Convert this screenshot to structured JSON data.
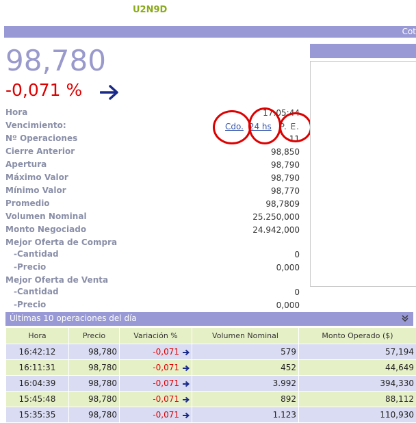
{
  "ticker": "U2N9D",
  "topbar_right": "Cot",
  "price": "98,780",
  "variation": "-0,071 %",
  "colors": {
    "accent": "#9999d6",
    "negative": "#dd0000",
    "row_odd": "#d9dcf2",
    "row_even": "#e6f0c6",
    "ticker": "#8aaa1a"
  },
  "details": {
    "hora": {
      "label": "Hora",
      "value": "17:05:44"
    },
    "vencimiento": {
      "label": "Vencimiento:",
      "link_cdo": "Cdo.",
      "link_24hs": "24 hs",
      "pe": "P. E."
    },
    "num_ops": {
      "label": "Nº Operaciones",
      "value": "11"
    },
    "cierre_anterior": {
      "label": "Cierre Anterior",
      "value": "98,850"
    },
    "apertura": {
      "label": "Apertura",
      "value": "98,790"
    },
    "maximo": {
      "label": "Máximo Valor",
      "value": "98,790"
    },
    "minimo": {
      "label": "Mínimo Valor",
      "value": "98,770"
    },
    "promedio": {
      "label": "Promedio",
      "value": "98,7809"
    },
    "vol_nominal": {
      "label": "Volumen Nominal",
      "value": "25.250,000"
    },
    "monto_neg": {
      "label": "Monto Negociado",
      "value": "24.942,000"
    },
    "mejor_compra": {
      "label": "Mejor Oferta de Compra"
    },
    "compra_cantidad": {
      "label": "-Cantidad",
      "value": "0"
    },
    "compra_precio": {
      "label": "-Precio",
      "value": "0,000"
    },
    "mejor_venta": {
      "label": "Mejor Oferta de Venta"
    },
    "venta_cantidad": {
      "label": "-Cantidad",
      "value": "0"
    },
    "venta_precio": {
      "label": "-Precio",
      "value": "0,000"
    }
  },
  "ops_table": {
    "title": "Últimas 10 operaciones del día",
    "headers": [
      "Hora",
      "Precio",
      "Variación %",
      "Volumen Nominal",
      "Monto Operado ($)"
    ],
    "rows": [
      {
        "hora": "16:42:12",
        "precio": "98,780",
        "var": "-0,071",
        "vol": "579",
        "monto": "57,194"
      },
      {
        "hora": "16:11:31",
        "precio": "98,780",
        "var": "-0,071",
        "vol": "452",
        "monto": "44,649"
      },
      {
        "hora": "16:04:39",
        "precio": "98,780",
        "var": "-0,071",
        "vol": "3.992",
        "monto": "394,330"
      },
      {
        "hora": "15:45:48",
        "precio": "98,780",
        "var": "-0,071",
        "vol": "892",
        "monto": "88,112"
      },
      {
        "hora": "15:35:35",
        "precio": "98,780",
        "var": "-0,071",
        "vol": "1.123",
        "monto": "110,930"
      }
    ]
  }
}
